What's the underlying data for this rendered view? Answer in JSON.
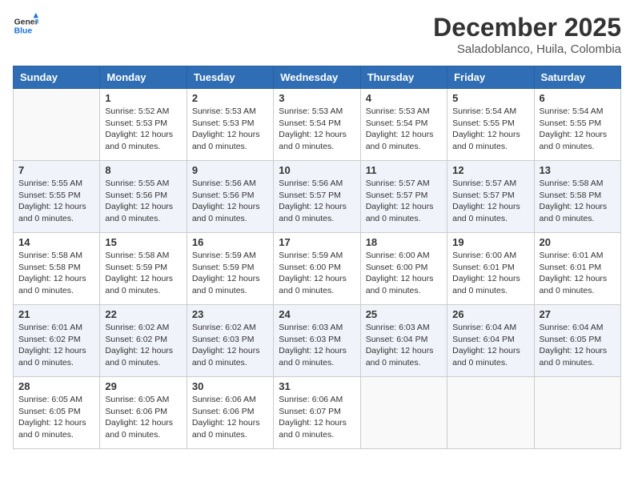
{
  "header": {
    "logo_line1": "General",
    "logo_line2": "Blue",
    "title": "December 2025",
    "subtitle": "Saladoblanco, Huila, Colombia"
  },
  "columns": [
    "Sunday",
    "Monday",
    "Tuesday",
    "Wednesday",
    "Thursday",
    "Friday",
    "Saturday"
  ],
  "weeks": [
    {
      "alt": false,
      "days": [
        {
          "num": "",
          "info": ""
        },
        {
          "num": "1",
          "info": "Sunrise: 5:52 AM\nSunset: 5:53 PM\nDaylight: 12 hours\nand 0 minutes."
        },
        {
          "num": "2",
          "info": "Sunrise: 5:53 AM\nSunset: 5:53 PM\nDaylight: 12 hours\nand 0 minutes."
        },
        {
          "num": "3",
          "info": "Sunrise: 5:53 AM\nSunset: 5:54 PM\nDaylight: 12 hours\nand 0 minutes."
        },
        {
          "num": "4",
          "info": "Sunrise: 5:53 AM\nSunset: 5:54 PM\nDaylight: 12 hours\nand 0 minutes."
        },
        {
          "num": "5",
          "info": "Sunrise: 5:54 AM\nSunset: 5:55 PM\nDaylight: 12 hours\nand 0 minutes."
        },
        {
          "num": "6",
          "info": "Sunrise: 5:54 AM\nSunset: 5:55 PM\nDaylight: 12 hours\nand 0 minutes."
        }
      ]
    },
    {
      "alt": true,
      "days": [
        {
          "num": "7",
          "info": "Sunrise: 5:55 AM\nSunset: 5:55 PM\nDaylight: 12 hours\nand 0 minutes."
        },
        {
          "num": "8",
          "info": "Sunrise: 5:55 AM\nSunset: 5:56 PM\nDaylight: 12 hours\nand 0 minutes."
        },
        {
          "num": "9",
          "info": "Sunrise: 5:56 AM\nSunset: 5:56 PM\nDaylight: 12 hours\nand 0 minutes."
        },
        {
          "num": "10",
          "info": "Sunrise: 5:56 AM\nSunset: 5:57 PM\nDaylight: 12 hours\nand 0 minutes."
        },
        {
          "num": "11",
          "info": "Sunrise: 5:57 AM\nSunset: 5:57 PM\nDaylight: 12 hours\nand 0 minutes."
        },
        {
          "num": "12",
          "info": "Sunrise: 5:57 AM\nSunset: 5:57 PM\nDaylight: 12 hours\nand 0 minutes."
        },
        {
          "num": "13",
          "info": "Sunrise: 5:58 AM\nSunset: 5:58 PM\nDaylight: 12 hours\nand 0 minutes."
        }
      ]
    },
    {
      "alt": false,
      "days": [
        {
          "num": "14",
          "info": "Sunrise: 5:58 AM\nSunset: 5:58 PM\nDaylight: 12 hours\nand 0 minutes."
        },
        {
          "num": "15",
          "info": "Sunrise: 5:58 AM\nSunset: 5:59 PM\nDaylight: 12 hours\nand 0 minutes."
        },
        {
          "num": "16",
          "info": "Sunrise: 5:59 AM\nSunset: 5:59 PM\nDaylight: 12 hours\nand 0 minutes."
        },
        {
          "num": "17",
          "info": "Sunrise: 5:59 AM\nSunset: 6:00 PM\nDaylight: 12 hours\nand 0 minutes."
        },
        {
          "num": "18",
          "info": "Sunrise: 6:00 AM\nSunset: 6:00 PM\nDaylight: 12 hours\nand 0 minutes."
        },
        {
          "num": "19",
          "info": "Sunrise: 6:00 AM\nSunset: 6:01 PM\nDaylight: 12 hours\nand 0 minutes."
        },
        {
          "num": "20",
          "info": "Sunrise: 6:01 AM\nSunset: 6:01 PM\nDaylight: 12 hours\nand 0 minutes."
        }
      ]
    },
    {
      "alt": true,
      "days": [
        {
          "num": "21",
          "info": "Sunrise: 6:01 AM\nSunset: 6:02 PM\nDaylight: 12 hours\nand 0 minutes."
        },
        {
          "num": "22",
          "info": "Sunrise: 6:02 AM\nSunset: 6:02 PM\nDaylight: 12 hours\nand 0 minutes."
        },
        {
          "num": "23",
          "info": "Sunrise: 6:02 AM\nSunset: 6:03 PM\nDaylight: 12 hours\nand 0 minutes."
        },
        {
          "num": "24",
          "info": "Sunrise: 6:03 AM\nSunset: 6:03 PM\nDaylight: 12 hours\nand 0 minutes."
        },
        {
          "num": "25",
          "info": "Sunrise: 6:03 AM\nSunset: 6:04 PM\nDaylight: 12 hours\nand 0 minutes."
        },
        {
          "num": "26",
          "info": "Sunrise: 6:04 AM\nSunset: 6:04 PM\nDaylight: 12 hours\nand 0 minutes."
        },
        {
          "num": "27",
          "info": "Sunrise: 6:04 AM\nSunset: 6:05 PM\nDaylight: 12 hours\nand 0 minutes."
        }
      ]
    },
    {
      "alt": false,
      "days": [
        {
          "num": "28",
          "info": "Sunrise: 6:05 AM\nSunset: 6:05 PM\nDaylight: 12 hours\nand 0 minutes."
        },
        {
          "num": "29",
          "info": "Sunrise: 6:05 AM\nSunset: 6:06 PM\nDaylight: 12 hours\nand 0 minutes."
        },
        {
          "num": "30",
          "info": "Sunrise: 6:06 AM\nSunset: 6:06 PM\nDaylight: 12 hours\nand 0 minutes."
        },
        {
          "num": "31",
          "info": "Sunrise: 6:06 AM\nSunset: 6:07 PM\nDaylight: 12 hours\nand 0 minutes."
        },
        {
          "num": "",
          "info": ""
        },
        {
          "num": "",
          "info": ""
        },
        {
          "num": "",
          "info": ""
        }
      ]
    }
  ]
}
